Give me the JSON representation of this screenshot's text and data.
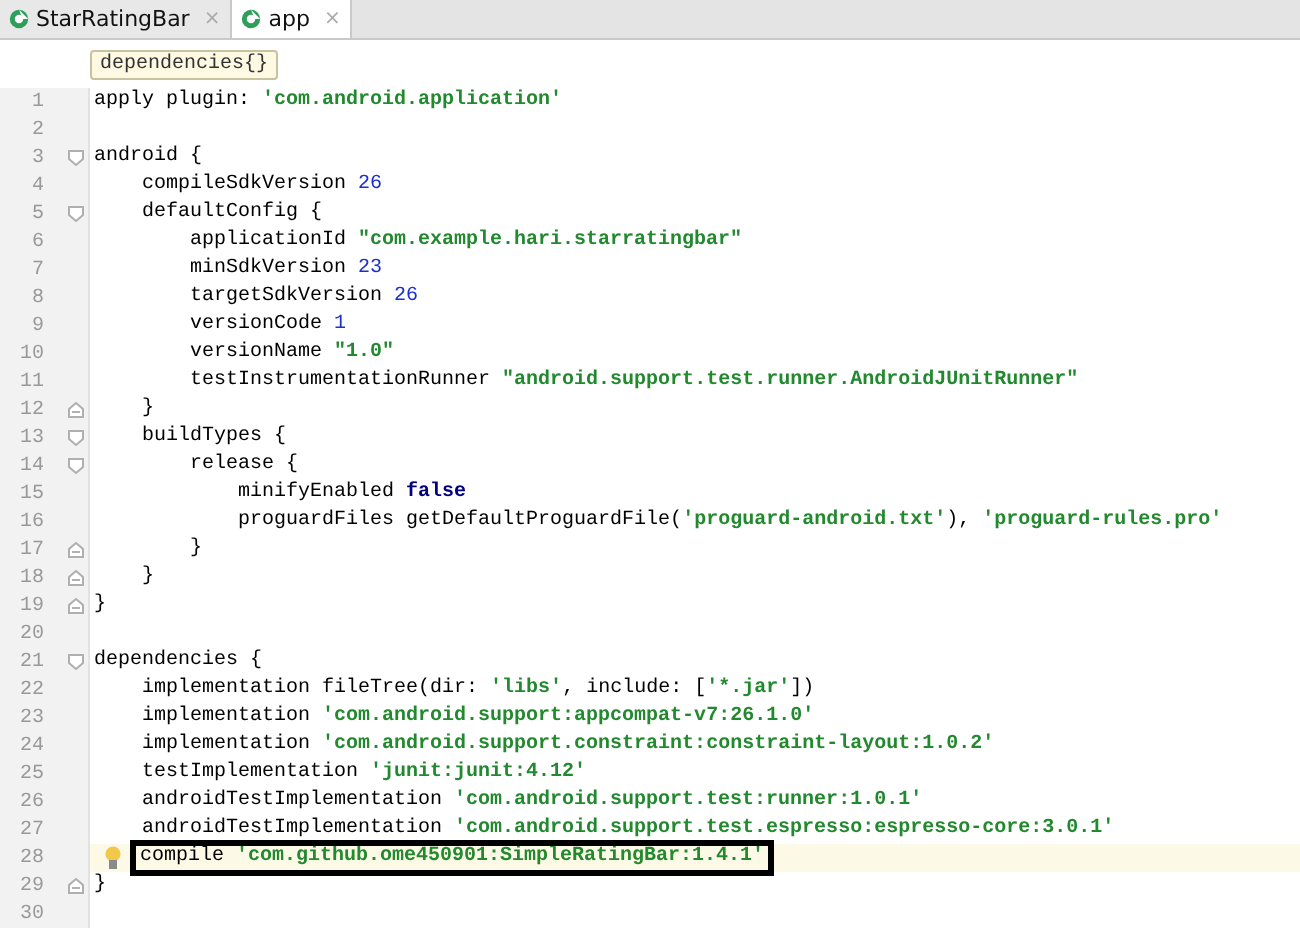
{
  "tabs": [
    {
      "label": "StarRatingBar",
      "selected": false,
      "close": "×"
    },
    {
      "label": "app",
      "selected": true,
      "close": "×"
    }
  ],
  "breadcrumb": "dependencies{}",
  "lines": [
    {
      "number": "1",
      "tokens": [
        {
          "text": "apply plugin: ",
          "kind": "plain"
        },
        {
          "text": "'com.android.application'",
          "kind": "string"
        }
      ]
    },
    {
      "number": "2"
    },
    {
      "number": "3",
      "fold_open": true,
      "tokens": [
        {
          "text": "android {",
          "kind": "plain"
        }
      ]
    },
    {
      "number": "4",
      "tokens": [
        {
          "text": "    compileSdkVersion ",
          "kind": "plain"
        },
        {
          "text": "26",
          "kind": "number"
        }
      ]
    },
    {
      "number": "5",
      "fold_open": true,
      "tokens": [
        {
          "text": "    defaultConfig {",
          "kind": "plain"
        }
      ]
    },
    {
      "number": "6",
      "tokens": [
        {
          "text": "        applicationId ",
          "kind": "plain"
        },
        {
          "text": "\"com.example.hari.starratingbar\"",
          "kind": "string"
        }
      ]
    },
    {
      "number": "7",
      "tokens": [
        {
          "text": "        minSdkVersion ",
          "kind": "plain"
        },
        {
          "text": "23",
          "kind": "number"
        }
      ]
    },
    {
      "number": "8",
      "tokens": [
        {
          "text": "        targetSdkVersion ",
          "kind": "plain"
        },
        {
          "text": "26",
          "kind": "number"
        }
      ]
    },
    {
      "number": "9",
      "tokens": [
        {
          "text": "        versionCode ",
          "kind": "plain"
        },
        {
          "text": "1",
          "kind": "number"
        }
      ]
    },
    {
      "number": "10",
      "tokens": [
        {
          "text": "        versionName ",
          "kind": "plain"
        },
        {
          "text": "\"1.0\"",
          "kind": "string"
        }
      ]
    },
    {
      "number": "11",
      "tokens": [
        {
          "text": "        testInstrumentationRunner ",
          "kind": "plain"
        },
        {
          "text": "\"android.support.test.runner.AndroidJUnitRunner\"",
          "kind": "string"
        }
      ]
    },
    {
      "number": "12",
      "fold_close": true,
      "tokens": [
        {
          "text": "    }",
          "kind": "plain"
        }
      ]
    },
    {
      "number": "13",
      "fold_open": true,
      "tokens": [
        {
          "text": "    buildTypes {",
          "kind": "plain"
        }
      ]
    },
    {
      "number": "14",
      "fold_open": true,
      "tokens": [
        {
          "text": "        release {",
          "kind": "plain"
        }
      ]
    },
    {
      "number": "15",
      "tokens": [
        {
          "text": "            minifyEnabled ",
          "kind": "plain"
        },
        {
          "text": "false",
          "kind": "keyword"
        }
      ]
    },
    {
      "number": "16",
      "tokens": [
        {
          "text": "            proguardFiles getDefaultProguardFile(",
          "kind": "plain"
        },
        {
          "text": "'proguard-android.txt'",
          "kind": "string"
        },
        {
          "text": "), ",
          "kind": "plain"
        },
        {
          "text": "'proguard-rules.pro'",
          "kind": "string"
        }
      ]
    },
    {
      "number": "17",
      "fold_close": true,
      "tokens": [
        {
          "text": "        }",
          "kind": "plain"
        }
      ]
    },
    {
      "number": "18",
      "fold_close": true,
      "tokens": [
        {
          "text": "    }",
          "kind": "plain"
        }
      ]
    },
    {
      "number": "19",
      "fold_close": true,
      "tokens": [
        {
          "text": "}",
          "kind": "plain"
        }
      ]
    },
    {
      "number": "20"
    },
    {
      "number": "21",
      "fold_open": true,
      "tokens": [
        {
          "text": "dependencies {",
          "kind": "plain"
        }
      ]
    },
    {
      "number": "22",
      "tokens": [
        {
          "text": "    implementation fileTree(dir: ",
          "kind": "plain"
        },
        {
          "text": "'libs'",
          "kind": "string"
        },
        {
          "text": ", include: [",
          "kind": "plain"
        },
        {
          "text": "'*.jar'",
          "kind": "string"
        },
        {
          "text": "])",
          "kind": "plain"
        }
      ]
    },
    {
      "number": "23",
      "tokens": [
        {
          "text": "    implementation ",
          "kind": "plain"
        },
        {
          "text": "'com.android.support:appcompat-v7:26.1.0'",
          "kind": "string"
        }
      ]
    },
    {
      "number": "24",
      "tokens": [
        {
          "text": "    implementation ",
          "kind": "plain"
        },
        {
          "text": "'com.android.support.constraint:constraint-layout:1.0.2'",
          "kind": "string"
        }
      ]
    },
    {
      "number": "25",
      "tokens": [
        {
          "text": "    testImplementation ",
          "kind": "plain"
        },
        {
          "text": "'junit:junit:4.12'",
          "kind": "string"
        }
      ]
    },
    {
      "number": "26",
      "tokens": [
        {
          "text": "    androidTestImplementation ",
          "kind": "plain"
        },
        {
          "text": "'com.android.support.test:runner:1.0.1'",
          "kind": "string"
        }
      ]
    },
    {
      "number": "27",
      "tokens": [
        {
          "text": "    androidTestImplementation ",
          "kind": "plain"
        },
        {
          "text": "'com.android.support.test.espresso:espresso-core:3.0.1'",
          "kind": "string"
        }
      ]
    },
    {
      "number": "28",
      "current": true,
      "boxed": true,
      "bulb": true,
      "tokens": [
        {
          "text": "compile ",
          "kind": "plain"
        },
        {
          "text": "'com.github.ome450901:SimpleRatingBar:1.4.1'",
          "kind": "string"
        }
      ]
    },
    {
      "number": "29",
      "fold_close": true,
      "tokens": [
        {
          "text": "}",
          "kind": "plain"
        }
      ]
    },
    {
      "number": "30"
    }
  ]
}
